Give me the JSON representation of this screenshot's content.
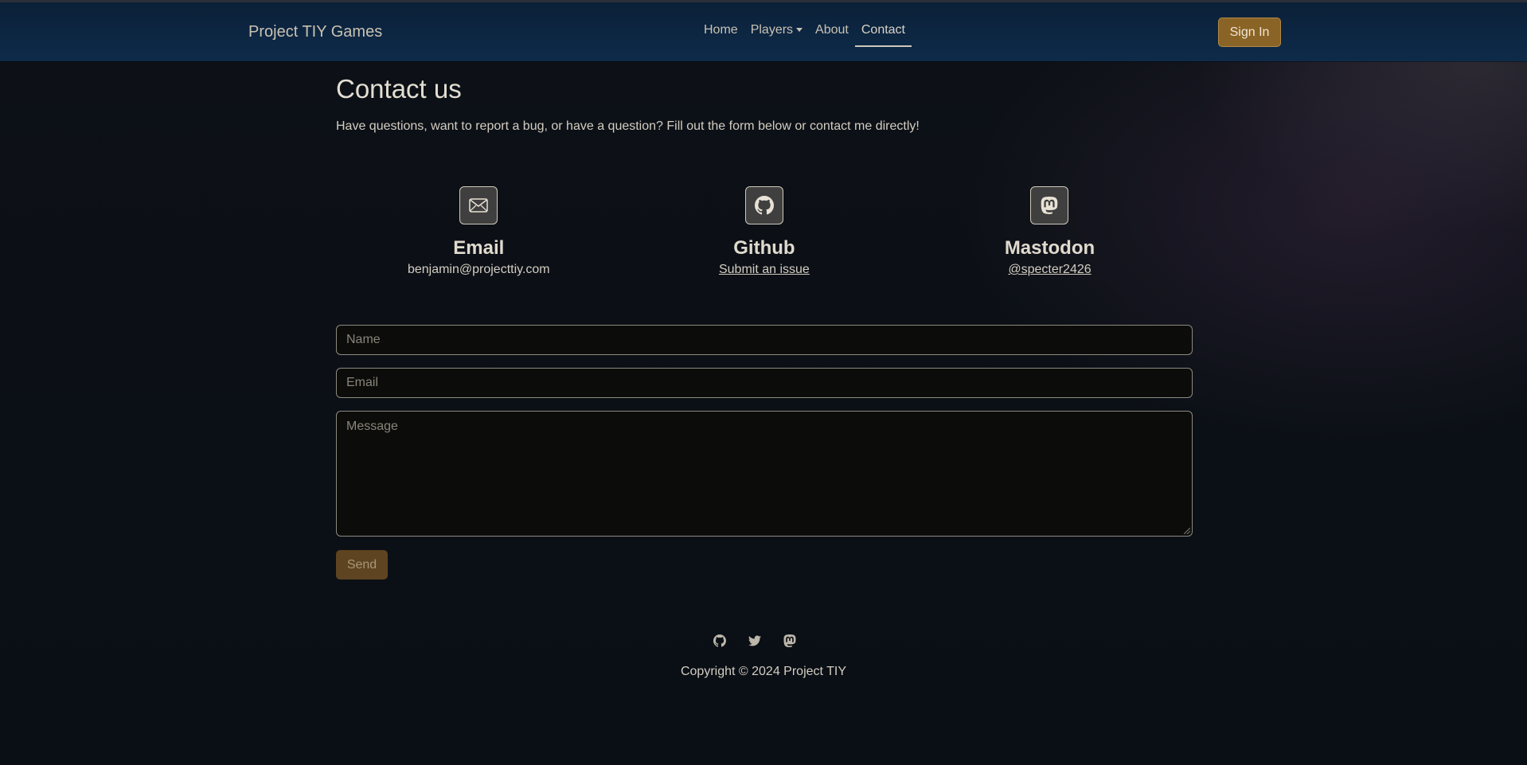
{
  "navbar": {
    "brand": "Project TIY Games",
    "links": [
      {
        "label": "Home"
      },
      {
        "label": "Players"
      },
      {
        "label": "About"
      },
      {
        "label": "Contact"
      }
    ],
    "sign_in": "Sign In"
  },
  "main": {
    "title": "Contact us",
    "intro": "Have questions, want to report a bug, or have a question? Fill out the form below or contact me directly!",
    "cards": [
      {
        "icon": "envelope-icon",
        "title": "Email",
        "text": "benjamin@projecttiy.com"
      },
      {
        "icon": "github-icon",
        "title": "Github",
        "text": "Submit an issue"
      },
      {
        "icon": "mastodon-icon",
        "title": "Mastodon",
        "text": "@specter2426"
      }
    ],
    "form": {
      "name_placeholder": "Name",
      "email_placeholder": "Email",
      "message_placeholder": "Message",
      "send_label": "Send"
    }
  },
  "footer": {
    "icons": [
      "github-icon",
      "twitter-icon",
      "mastodon-icon"
    ],
    "copyright": "Copyright © 2024 Project TIY"
  },
  "colors": {
    "navbar": "#0e2b4a",
    "accent": "#8a6426",
    "background": "#0d1117"
  }
}
